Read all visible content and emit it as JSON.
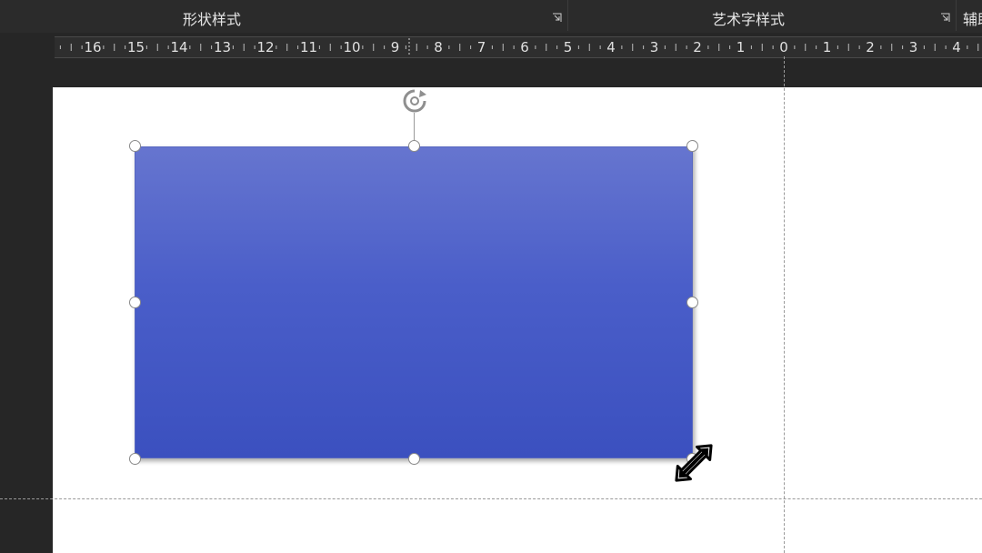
{
  "ribbon": {
    "groups": [
      {
        "label": "形状样式"
      },
      {
        "label": "艺术字样式"
      },
      {
        "label": "辅助"
      }
    ]
  },
  "ruler": {
    "unit": "cm",
    "left_labels": [
      "16",
      "15",
      "14",
      "13",
      "12",
      "11",
      "10",
      "9",
      "8",
      "7",
      "6",
      "5",
      "4",
      "3",
      "2",
      "1",
      "0"
    ],
    "right_labels": [
      "1",
      "2",
      "3",
      "4"
    ]
  },
  "shape": {
    "type": "rectangle",
    "fill_top": "#6675cf",
    "fill_bottom": "#3b50bf",
    "selected": true
  },
  "cursor": {
    "icon": "resize-diagonal-cursor-icon"
  }
}
